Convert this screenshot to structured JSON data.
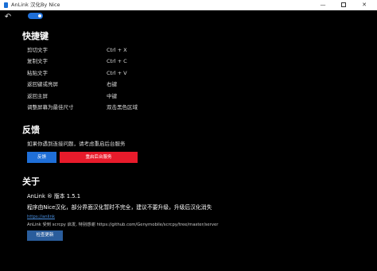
{
  "window": {
    "title": "AnLink 汉化By Nice",
    "minimize": "—",
    "close": "✕"
  },
  "nav": {
    "back_icon": "back-arrow-icon",
    "back_glyph": "↶"
  },
  "toggle": {
    "state": "on",
    "accent": "#1f6fd8"
  },
  "shortcuts": {
    "title": "快捷键",
    "items": [
      {
        "desc": "剪切文字",
        "key": "Ctrl + X"
      },
      {
        "desc": "复制文字",
        "key": "Ctrl + C"
      },
      {
        "desc": "粘贴文字",
        "key": "Ctrl + V"
      },
      {
        "desc": "返回键或亮屏",
        "key": "右键"
      },
      {
        "desc": "返回主屏",
        "key": "中键"
      },
      {
        "desc": "调整屏幕为最佳尺寸",
        "key": "双击黑色区域"
      }
    ]
  },
  "feedback": {
    "title": "反馈",
    "description": "如果你遇到连接问题，请考虑重启后台服务",
    "feedback_button": "反馈",
    "restart_button": "重启后台服务",
    "colors": {
      "feedback": "#1f6fd8",
      "restart": "#e81b2b"
    }
  },
  "about": {
    "title": "关于",
    "version": "AnLink ® 版本 1.5.1",
    "note": "程序由Nice汉化，部分界面汉化暂时不完全，建议不要升级，升级后汉化消失",
    "link": "https://anlink",
    "credit": "AnLink 受到 scrcpy 启发, 特别感谢 https://github.com/Genymobile/scrcpy/tree/master/server",
    "update_button": "检查更新"
  }
}
